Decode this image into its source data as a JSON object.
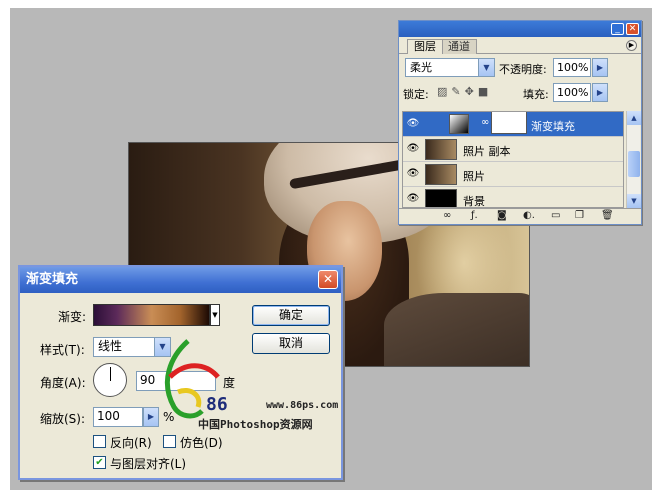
{
  "layers_panel": {
    "tabs": [
      "图层",
      "通道"
    ],
    "blend_mode": "柔光",
    "opacity_label": "不透明度:",
    "opacity_value": "100%",
    "lock_label": "锁定:",
    "fill_label": "填充:",
    "fill_value": "100%",
    "layers": [
      {
        "name": "渐变填充",
        "selected": true
      },
      {
        "name": "照片 副本",
        "selected": false
      },
      {
        "name": "照片",
        "selected": false
      },
      {
        "name": "背景",
        "selected": false
      }
    ]
  },
  "dialog": {
    "title": "渐变填充",
    "gradient_label": "渐变:",
    "style_label": "样式(T):",
    "style_value": "线性",
    "angle_label": "角度(A):",
    "angle_value": "90",
    "angle_unit": "度",
    "scale_label": "缩放(S):",
    "scale_value": "100",
    "scale_unit": "%",
    "ok_label": "确定",
    "cancel_label": "取消",
    "reverse_label": "反向(R)",
    "reverse_checked": false,
    "dither_label": "仿色(D)",
    "dither_checked": false,
    "align_label": "与图层对齐(L)",
    "align_checked": true
  },
  "watermark": {
    "site_number": "86",
    "url": "www.86ps.com",
    "name": "中国Photoshop资源网"
  },
  "icons": {
    "eye": "eye-icon",
    "link": "chain-link-icon",
    "close": "close-icon",
    "minimize": "minimize-icon",
    "dropdown": "chevron-down-icon",
    "arrow_right": "triangle-right-icon",
    "panel_menu": "panel-menu-icon"
  },
  "colors": {
    "selected_layer": "#316ac5",
    "titlebar": "#2a5fbf",
    "dialog_bg": "#ece9d8"
  }
}
